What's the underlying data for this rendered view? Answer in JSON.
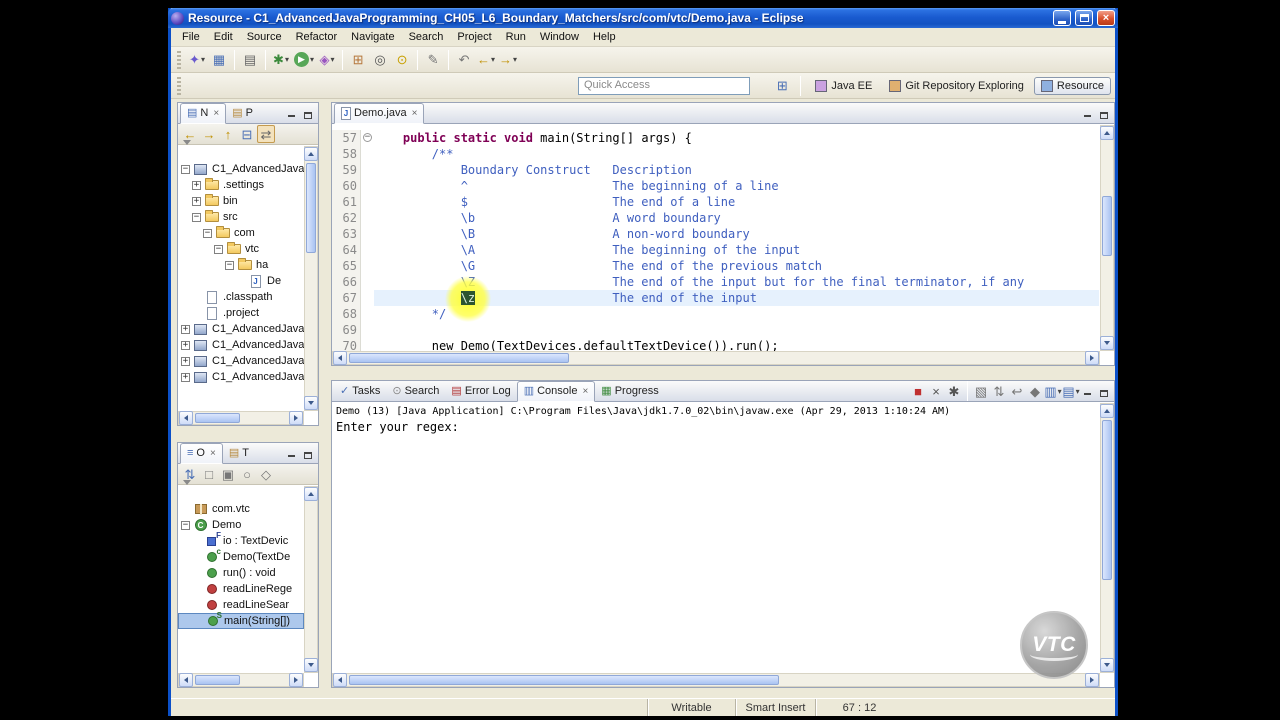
{
  "window": {
    "title": "Resource - C1_AdvancedJavaProgramming_CH05_L6_Boundary_Matchers/src/com/vtc/Demo.java - Eclipse"
  },
  "menubar": [
    "File",
    "Edit",
    "Source",
    "Refactor",
    "Navigate",
    "Search",
    "Project",
    "Run",
    "Window",
    "Help"
  ],
  "toolbar1": [
    {
      "name": "new-wizard",
      "glyph": "✦",
      "color": "#6a5acd",
      "dropdown": true
    },
    {
      "name": "save",
      "glyph": "▦",
      "color": "#4a6fb5"
    },
    {
      "sep": true
    },
    {
      "name": "print",
      "glyph": "▤",
      "color": "#666666"
    },
    {
      "sep": true
    },
    {
      "name": "debug",
      "glyph": "✱",
      "color": "#3c8a3c",
      "dropdown": true
    },
    {
      "name": "run",
      "glyph": "▶",
      "round": "#58a758",
      "color": "#ffffff",
      "dropdown": true
    },
    {
      "name": "external-tools",
      "glyph": "◈",
      "color": "#9a55c0",
      "dropdown": true
    },
    {
      "sep": true
    },
    {
      "name": "new-java-project",
      "glyph": "⊞",
      "color": "#b5763a"
    },
    {
      "name": "open-type",
      "glyph": "◎",
      "color": "#555555"
    },
    {
      "name": "search",
      "glyph": "⊙",
      "color": "#c8a000"
    },
    {
      "sep": true
    },
    {
      "name": "mark-occurrences",
      "glyph": "✎",
      "color": "#777777"
    },
    {
      "sep": true
    },
    {
      "name": "last-edit-location",
      "glyph": "↶",
      "color": "#777777"
    },
    {
      "name": "back",
      "glyph": "←",
      "color": "#c09000",
      "dropdown": true
    },
    {
      "name": "forward",
      "glyph": "→",
      "color": "#c09000",
      "dropdown": true
    }
  ],
  "toolbar2": {
    "quick_access": "Quick Access",
    "open_perspective_glyph": "⊞",
    "perspectives": [
      {
        "name": "java-ee",
        "label": "Java EE",
        "active": false,
        "icon_color": "#caa2e0"
      },
      {
        "name": "git-repository-exploring",
        "label": "Git Repository Exploring",
        "active": false,
        "icon_color": "#e0b070"
      },
      {
        "name": "resource",
        "label": "Resource",
        "active": true,
        "icon_color": "#8fb0e0"
      }
    ]
  },
  "navigator": {
    "tabs": [
      {
        "name": "project-explorer",
        "label": "N",
        "glyph": "▤",
        "color": "#4a6fb5",
        "closable": true,
        "active": true
      },
      {
        "name": "package-explorer",
        "label": "P",
        "glyph": "▤",
        "color": "#b5873a",
        "closable": false,
        "active": false
      }
    ],
    "toolbar": [
      {
        "name": "back",
        "glyph": "←",
        "color": "#c09000"
      },
      {
        "name": "forward",
        "glyph": "→",
        "color": "#c09000"
      },
      {
        "name": "up",
        "glyph": "↑",
        "color": "#c09000"
      },
      {
        "name": "collapse-all",
        "glyph": "⊟",
        "color": "#4a6fb5"
      },
      {
        "name": "link-with-editor",
        "glyph": "⇄",
        "color": "#666666",
        "pressed": true
      }
    ],
    "items": [
      {
        "indent": 0,
        "expander": "-",
        "icon": "project",
        "label": "C1_AdvancedJava"
      },
      {
        "indent": 1,
        "expander": "+",
        "icon": "folder",
        "label": ".settings"
      },
      {
        "indent": 1,
        "expander": "+",
        "icon": "folder",
        "label": "bin"
      },
      {
        "indent": 1,
        "expander": "-",
        "icon": "folder",
        "label": "src"
      },
      {
        "indent": 2,
        "expander": "-",
        "icon": "folder",
        "label": "com"
      },
      {
        "indent": 3,
        "expander": "-",
        "icon": "folder",
        "label": "vtc"
      },
      {
        "indent": 4,
        "expander": "-",
        "icon": "folder",
        "label": "ha"
      },
      {
        "indent": 5,
        "expander": "",
        "icon": "jfile",
        "label": "De"
      },
      {
        "indent": 1,
        "expander": "",
        "icon": "file",
        "label": ".classpath"
      },
      {
        "indent": 1,
        "expander": "",
        "icon": "file",
        "label": ".project"
      },
      {
        "indent": 0,
        "expander": "+",
        "icon": "project",
        "label": "C1_AdvancedJava"
      },
      {
        "indent": 0,
        "expander": "+",
        "icon": "project",
        "label": "C1_AdvancedJava"
      },
      {
        "indent": 0,
        "expander": "+",
        "icon": "project",
        "label": "C1_AdvancedJava"
      },
      {
        "indent": 0,
        "expander": "+",
        "icon": "project",
        "label": "C1_AdvancedJava"
      }
    ]
  },
  "outline": {
    "tabs": [
      {
        "name": "outline",
        "label": "O",
        "glyph": "≡",
        "color": "#4a6fb5",
        "closable": true,
        "active": true
      },
      {
        "name": "templates",
        "label": "T",
        "glyph": "▤",
        "color": "#b5873a",
        "closable": false,
        "active": false
      }
    ],
    "toolbar": [
      {
        "name": "sort",
        "glyph": "⇅",
        "color": "#4a6fb5"
      },
      {
        "name": "hide-fields",
        "glyph": "□",
        "color": "#777777"
      },
      {
        "name": "hide-static-members",
        "glyph": "▣",
        "color": "#777777"
      },
      {
        "name": "hide-non-public-members",
        "glyph": "○",
        "color": "#777777"
      },
      {
        "name": "hide-local-types",
        "glyph": "◇",
        "color": "#777777"
      }
    ],
    "items": [
      {
        "indent": 0,
        "expander": "",
        "icon": "package",
        "label": "com.vtc"
      },
      {
        "indent": 0,
        "expander": "-",
        "icon": "class",
        "label": "Demo"
      },
      {
        "indent": 1,
        "expander": "",
        "icon": "field",
        "label": "io : TextDevic"
      },
      {
        "indent": 1,
        "expander": "",
        "icon": "ctor",
        "label": "Demo(TextDe"
      },
      {
        "indent": 1,
        "expander": "",
        "icon": "method_pub",
        "label": "run() : void"
      },
      {
        "indent": 1,
        "expander": "",
        "icon": "method_pri",
        "label": "readLineRege"
      },
      {
        "indent": 1,
        "expander": "",
        "icon": "method_pri",
        "label": "readLineSear"
      },
      {
        "indent": 1,
        "expander": "",
        "icon": "method_static",
        "label": "main(String[])",
        "selected": true
      }
    ]
  },
  "editor": {
    "tab": {
      "label": "Demo.java"
    },
    "lines": [
      {
        "num": "57",
        "fold": true,
        "segments": [
          {
            "text": "    ",
            "style": "plain"
          },
          {
            "text": "public static void",
            "style": "keyword"
          },
          {
            "text": " main(String[] args) {",
            "style": "plain"
          }
        ]
      },
      {
        "num": "58",
        "segments": [
          {
            "text": "        /**",
            "style": "comment"
          }
        ]
      },
      {
        "num": "59",
        "segments": [
          {
            "text": "            Boundary Construct   Description",
            "style": "comment"
          }
        ]
      },
      {
        "num": "60",
        "segments": [
          {
            "text": "            ^                    The beginning of a line",
            "style": "comment"
          }
        ]
      },
      {
        "num": "61",
        "segments": [
          {
            "text": "            $                    The end of a line",
            "style": "comment"
          }
        ]
      },
      {
        "num": "62",
        "segments": [
          {
            "text": "            \\b                   A word boundary",
            "style": "comment"
          }
        ]
      },
      {
        "num": "63",
        "segments": [
          {
            "text": "            \\B                   A non-word boundary",
            "style": "comment"
          }
        ]
      },
      {
        "num": "64",
        "segments": [
          {
            "text": "            \\A                   The beginning of the input",
            "style": "comment"
          }
        ]
      },
      {
        "num": "65",
        "segments": [
          {
            "text": "            \\G                   The end of the previous match",
            "style": "comment"
          }
        ]
      },
      {
        "num": "66",
        "segments": [
          {
            "text": "            \\Z                   The end of the input but for the final terminator, if any",
            "style": "comment"
          }
        ]
      },
      {
        "num": "67",
        "current": true,
        "segments": [
          {
            "text": "            ",
            "style": "comment"
          },
          {
            "text": "\\z",
            "style": "selected"
          },
          {
            "text": "                   The end of the input",
            "style": "comment"
          }
        ]
      },
      {
        "num": "68",
        "segments": [
          {
            "text": "        */",
            "style": "comment"
          }
        ]
      },
      {
        "num": "69",
        "segments": []
      },
      {
        "num": "70",
        "segments": [
          {
            "text": "        new Demo(TextDevices.defaultTextDevice()).run();",
            "style": "plain"
          }
        ]
      }
    ]
  },
  "console": {
    "tabs": [
      {
        "name": "tasks",
        "label": "Tasks",
        "glyph": "✓",
        "color": "#4a6fb5",
        "active": false
      },
      {
        "name": "search",
        "label": "Search",
        "glyph": "⊙",
        "color": "#888888",
        "active": false
      },
      {
        "name": "error-log",
        "label": "Error Log",
        "glyph": "▤",
        "color": "#b03030",
        "active": false
      },
      {
        "name": "console",
        "label": "Console",
        "glyph": "▥",
        "color": "#4a6fb5",
        "active": true,
        "closable": true
      },
      {
        "name": "progress",
        "label": "Progress",
        "glyph": "▦",
        "color": "#3c8a3c",
        "active": false
      }
    ],
    "toolbar": [
      {
        "name": "terminate",
        "glyph": "■",
        "color": "#c03030"
      },
      {
        "name": "remove-launch",
        "glyph": "×",
        "color": "#555555"
      },
      {
        "name": "remove-all-launches",
        "glyph": "✱",
        "color": "#555555"
      },
      {
        "sep": true
      },
      {
        "name": "clear-console",
        "glyph": "▧",
        "color": "#777777"
      },
      {
        "name": "scroll-lock",
        "glyph": "⇅",
        "color": "#777777"
      },
      {
        "name": "word-wrap",
        "glyph": "↩",
        "color": "#777777"
      },
      {
        "name": "pin-console",
        "glyph": "◆",
        "color": "#777777"
      },
      {
        "name": "display-selected-console",
        "glyph": "▥",
        "color": "#4a6fb5",
        "dropdown": true
      },
      {
        "name": "open-console",
        "glyph": "▤",
        "color": "#4a6fb5",
        "dropdown": true
      }
    ],
    "header": "Demo (13) [Java Application] C:\\Program Files\\Java\\jdk1.7.0_02\\bin\\javaw.exe (Apr 29, 2013 1:10:24 AM)",
    "output": "Enter your regex:"
  },
  "statusbar": {
    "items": [
      {
        "name": "writable-state",
        "label": "Writable"
      },
      {
        "name": "insert-mode",
        "label": "Smart Insert"
      },
      {
        "name": "cursor-position",
        "label": "67 : 12"
      }
    ]
  },
  "watermark": {
    "text": "VTC"
  }
}
